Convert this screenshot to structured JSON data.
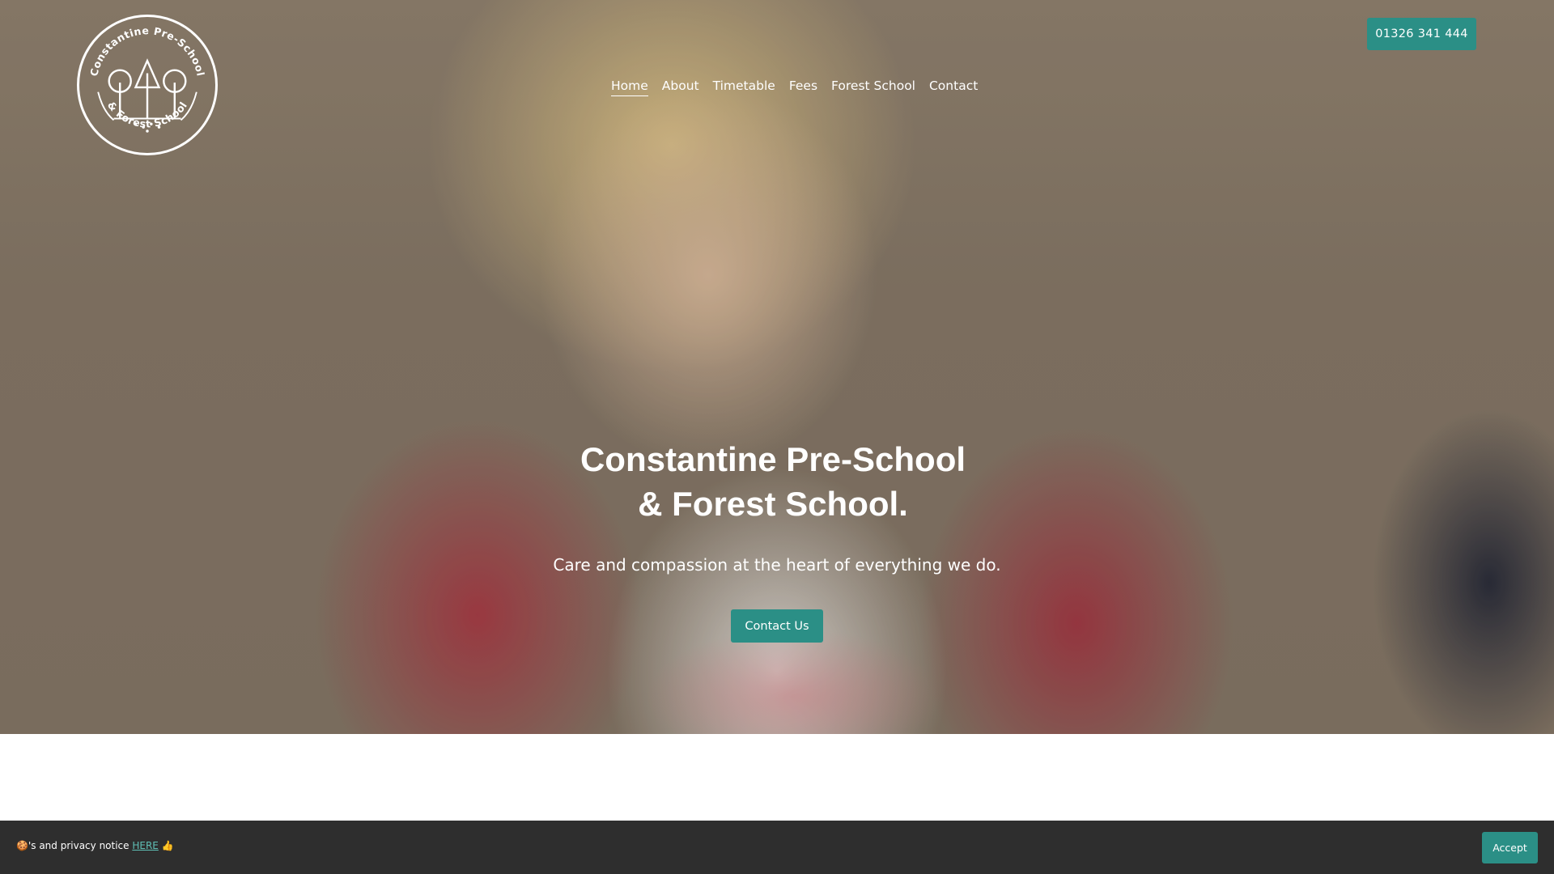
{
  "brand": {
    "logo_ring_text_top": "Constantine Pre-School",
    "logo_ring_text_bottom": "& Forest School"
  },
  "nav": {
    "items": [
      {
        "label": "Home",
        "active": true
      },
      {
        "label": "About",
        "active": false
      },
      {
        "label": "Timetable",
        "active": false
      },
      {
        "label": "Fees",
        "active": false
      },
      {
        "label": "Forest School",
        "active": false
      },
      {
        "label": "Contact",
        "active": false
      }
    ]
  },
  "header": {
    "phone_button_label": "01326 341 444"
  },
  "hero": {
    "title_line1": "Constantine Pre-School",
    "title_line2": "& Forest School.",
    "subtitle": "Care and compassion at the heart of everything we do.",
    "cta_label": "Contact Us"
  },
  "cookie_banner": {
    "cookie_emoji": "🍪",
    "text": "'s and privacy notice ",
    "link_label": "HERE",
    "thumbs_emoji": "👍",
    "accept_label": "Accept"
  },
  "colors": {
    "accent": "#2b8f86",
    "cookie_bar_bg": "#2e2e2e",
    "link": "#5fbfb5",
    "text_on_hero": "#ffffff"
  },
  "icons": {
    "logo": "school-logo-trees-icon",
    "cookie": "cookie-icon",
    "thumbs_up": "thumbs-up-icon"
  }
}
